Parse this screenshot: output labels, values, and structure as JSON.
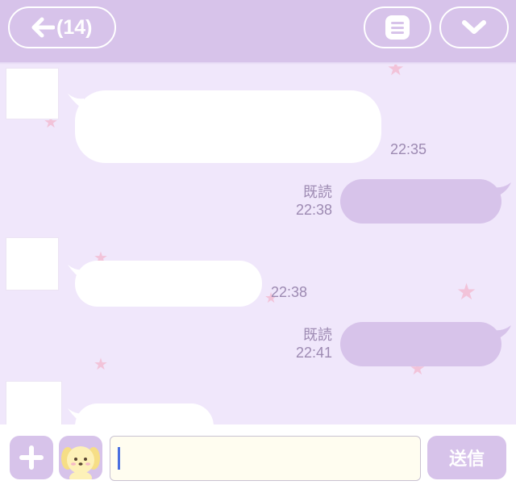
{
  "header": {
    "unread_count": "(14)",
    "colors": {
      "bar": "#d7c3ea",
      "icon": "#ffffff"
    },
    "icons": [
      "back-arrow-icon",
      "menu-icon",
      "chevron-down-icon"
    ]
  },
  "messages": [
    {
      "direction": "incoming",
      "time": "22:35"
    },
    {
      "direction": "outgoing",
      "read_label": "既読",
      "time": "22:38"
    },
    {
      "direction": "incoming",
      "time": "22:38"
    },
    {
      "direction": "outgoing",
      "read_label": "既読",
      "time": "22:41"
    },
    {
      "direction": "incoming",
      "time": ""
    }
  ],
  "composer": {
    "value": "",
    "send_label": "送信",
    "icons": [
      "plus-icon",
      "sticker-dog-icon"
    ]
  },
  "colors": {
    "background": "#f0e7fb",
    "accent": "#d7c3ea",
    "incoming_bubble": "#ffffff",
    "outgoing_bubble": "#d7c3ea",
    "meta_text": "#9d8ab2",
    "star": "#f2c3d9"
  }
}
